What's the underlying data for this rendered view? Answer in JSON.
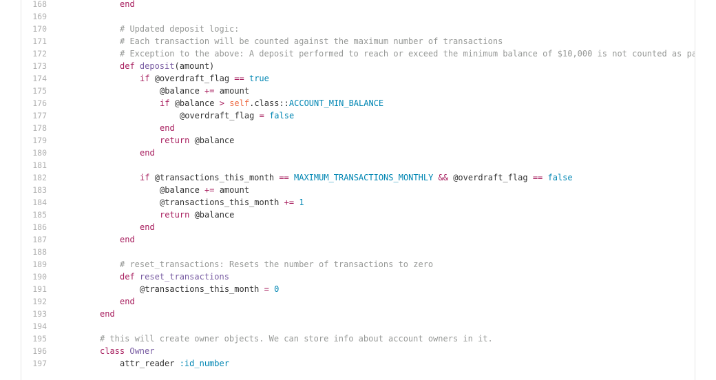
{
  "colors": {
    "keyword": "#a71d5d",
    "comment": "#969896",
    "function": "#795da3",
    "constant": "#0086b3",
    "self": "#ed6a43",
    "text": "#333333",
    "line_number": "#b0b0b0"
  },
  "lines": [
    {
      "num": "168",
      "indent": 2,
      "tokens": [
        {
          "t": "end",
          "c": "kw"
        }
      ]
    },
    {
      "num": "169",
      "indent": 0,
      "tokens": []
    },
    {
      "num": "170",
      "indent": 2,
      "tokens": [
        {
          "t": "# Updated deposit logic:",
          "c": "cm"
        }
      ]
    },
    {
      "num": "171",
      "indent": 2,
      "tokens": [
        {
          "t": "# Each transaction will be counted against the maximum number of transactions",
          "c": "cm"
        }
      ]
    },
    {
      "num": "172",
      "indent": 2,
      "tokens": [
        {
          "t": "# Exception to the above: A deposit performed to reach or exceed the minimum balance of $10,000 is not counted as part o",
          "c": "cm"
        }
      ]
    },
    {
      "num": "173",
      "indent": 2,
      "tokens": [
        {
          "t": "def ",
          "c": "kw"
        },
        {
          "t": "deposit",
          "c": "fn"
        },
        {
          "t": "(amount)",
          "c": "plain"
        }
      ]
    },
    {
      "num": "174",
      "indent": 3,
      "tokens": [
        {
          "t": "if ",
          "c": "kw"
        },
        {
          "t": "@overdraft_flag ",
          "c": "plain"
        },
        {
          "t": "==",
          "c": "kw"
        },
        {
          "t": " ",
          "c": "plain"
        },
        {
          "t": "true",
          "c": "const"
        }
      ]
    },
    {
      "num": "175",
      "indent": 4,
      "tokens": [
        {
          "t": "@balance ",
          "c": "plain"
        },
        {
          "t": "+=",
          "c": "kw"
        },
        {
          "t": " amount",
          "c": "plain"
        }
      ]
    },
    {
      "num": "176",
      "indent": 4,
      "tokens": [
        {
          "t": "if ",
          "c": "kw"
        },
        {
          "t": "@balance ",
          "c": "plain"
        },
        {
          "t": ">",
          "c": "kw"
        },
        {
          "t": " ",
          "c": "plain"
        },
        {
          "t": "self",
          "c": "self"
        },
        {
          "t": ".class::",
          "c": "plain"
        },
        {
          "t": "ACCOUNT_MIN_BALANCE",
          "c": "const"
        }
      ]
    },
    {
      "num": "177",
      "indent": 5,
      "tokens": [
        {
          "t": "@overdraft_flag ",
          "c": "plain"
        },
        {
          "t": "=",
          "c": "kw"
        },
        {
          "t": " ",
          "c": "plain"
        },
        {
          "t": "false",
          "c": "const"
        }
      ]
    },
    {
      "num": "178",
      "indent": 4,
      "tokens": [
        {
          "t": "end",
          "c": "kw"
        }
      ]
    },
    {
      "num": "179",
      "indent": 4,
      "tokens": [
        {
          "t": "return ",
          "c": "kw"
        },
        {
          "t": "@balance",
          "c": "plain"
        }
      ]
    },
    {
      "num": "180",
      "indent": 3,
      "tokens": [
        {
          "t": "end",
          "c": "kw"
        }
      ]
    },
    {
      "num": "181",
      "indent": 0,
      "tokens": []
    },
    {
      "num": "182",
      "indent": 3,
      "tokens": [
        {
          "t": "if ",
          "c": "kw"
        },
        {
          "t": "@transactions_this_month ",
          "c": "plain"
        },
        {
          "t": "==",
          "c": "kw"
        },
        {
          "t": " ",
          "c": "plain"
        },
        {
          "t": "MAXIMUM_TRANSACTIONS_MONTHLY",
          "c": "const"
        },
        {
          "t": " ",
          "c": "plain"
        },
        {
          "t": "&&",
          "c": "kw"
        },
        {
          "t": " @overdraft_flag ",
          "c": "plain"
        },
        {
          "t": "==",
          "c": "kw"
        },
        {
          "t": " ",
          "c": "plain"
        },
        {
          "t": "false",
          "c": "const"
        }
      ]
    },
    {
      "num": "183",
      "indent": 4,
      "tokens": [
        {
          "t": "@balance ",
          "c": "plain"
        },
        {
          "t": "+=",
          "c": "kw"
        },
        {
          "t": " amount",
          "c": "plain"
        }
      ]
    },
    {
      "num": "184",
      "indent": 4,
      "tokens": [
        {
          "t": "@transactions_this_month ",
          "c": "plain"
        },
        {
          "t": "+=",
          "c": "kw"
        },
        {
          "t": " ",
          "c": "plain"
        },
        {
          "t": "1",
          "c": "const"
        }
      ]
    },
    {
      "num": "185",
      "indent": 4,
      "tokens": [
        {
          "t": "return ",
          "c": "kw"
        },
        {
          "t": "@balance",
          "c": "plain"
        }
      ]
    },
    {
      "num": "186",
      "indent": 3,
      "tokens": [
        {
          "t": "end",
          "c": "kw"
        }
      ]
    },
    {
      "num": "187",
      "indent": 2,
      "tokens": [
        {
          "t": "end",
          "c": "kw"
        }
      ]
    },
    {
      "num": "188",
      "indent": 0,
      "tokens": []
    },
    {
      "num": "189",
      "indent": 2,
      "tokens": [
        {
          "t": "# reset_transactions: Resets the number of transactions to zero",
          "c": "cm"
        }
      ]
    },
    {
      "num": "190",
      "indent": 2,
      "tokens": [
        {
          "t": "def ",
          "c": "kw"
        },
        {
          "t": "reset_transactions",
          "c": "fn"
        }
      ]
    },
    {
      "num": "191",
      "indent": 3,
      "tokens": [
        {
          "t": "@transactions_this_month ",
          "c": "plain"
        },
        {
          "t": "=",
          "c": "kw"
        },
        {
          "t": " ",
          "c": "plain"
        },
        {
          "t": "0",
          "c": "const"
        }
      ]
    },
    {
      "num": "192",
      "indent": 2,
      "tokens": [
        {
          "t": "end",
          "c": "kw"
        }
      ]
    },
    {
      "num": "193",
      "indent": 1,
      "tokens": [
        {
          "t": "end",
          "c": "kw"
        }
      ]
    },
    {
      "num": "194",
      "indent": 0,
      "tokens": []
    },
    {
      "num": "195",
      "indent": 1,
      "tokens": [
        {
          "t": "# this will create owner objects. We can store info about account owners in it.",
          "c": "cm"
        }
      ]
    },
    {
      "num": "196",
      "indent": 1,
      "tokens": [
        {
          "t": "class ",
          "c": "kw"
        },
        {
          "t": "Owner",
          "c": "fn"
        }
      ]
    },
    {
      "num": "197",
      "indent": 2,
      "tokens": [
        {
          "t": "attr_reader ",
          "c": "plain"
        },
        {
          "t": ":id_number",
          "c": "const"
        }
      ]
    }
  ]
}
